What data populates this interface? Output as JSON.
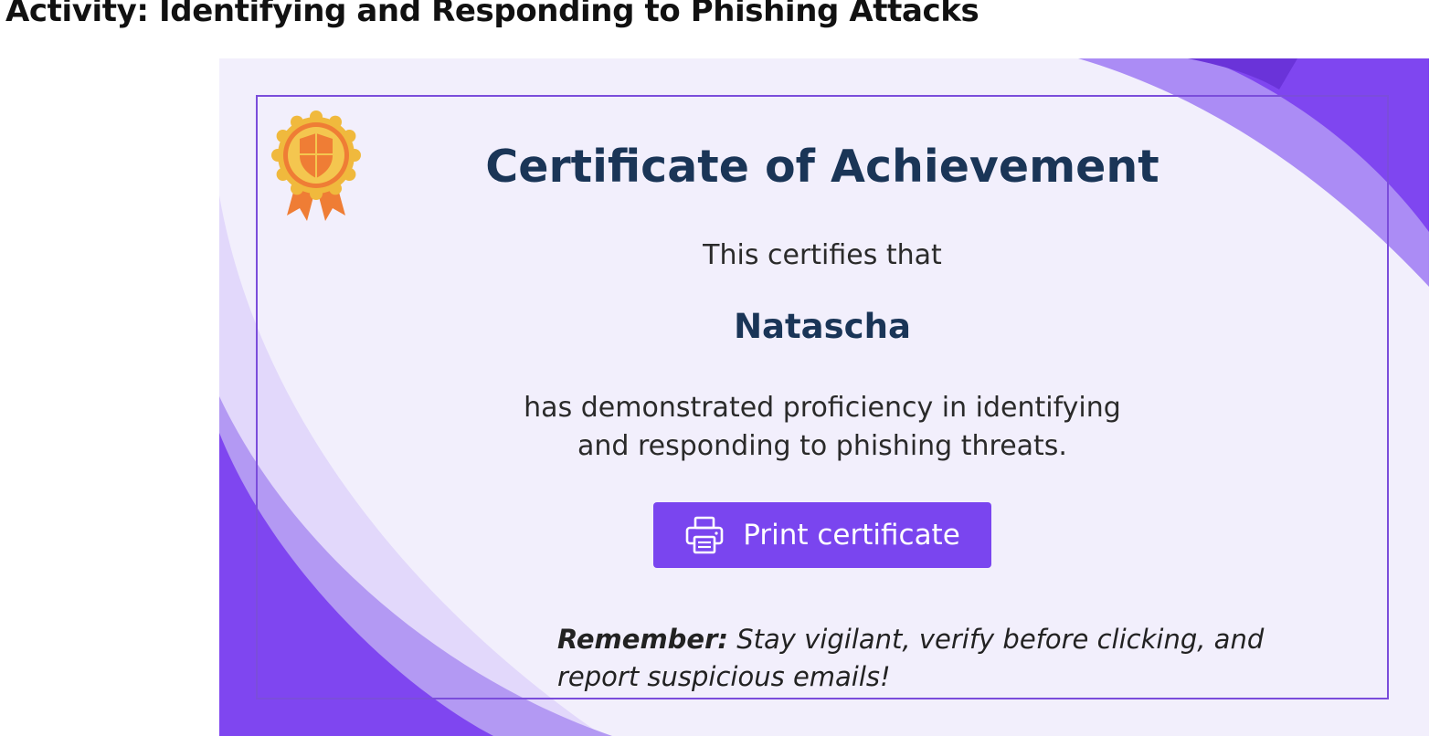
{
  "page": {
    "heading": "Activity: Identifying and Responding to Phishing Attacks"
  },
  "certificate": {
    "title": "Certificate of Achievement",
    "intro": "This certifies that",
    "recipient_name": "Natascha",
    "description_line1": "has demonstrated proficiency in identifying",
    "description_line2": "and responding to phishing threats.",
    "badge_icon": "award-shield-icon",
    "print_button": {
      "label": "Print certificate",
      "icon": "printer-icon"
    },
    "reminder": {
      "lead": "Remember:",
      "line1_rest": "Stay vigilant, verify before clicking, and",
      "line2": "report suspicious emails!"
    }
  },
  "colors": {
    "accent_purple": "#7a45ef",
    "frame_border": "#7b4ddb",
    "title_navy": "#1a3557",
    "card_background": "#f2effc",
    "badge_gold": "#f0b93d",
    "badge_orange": "#ef7d35"
  }
}
